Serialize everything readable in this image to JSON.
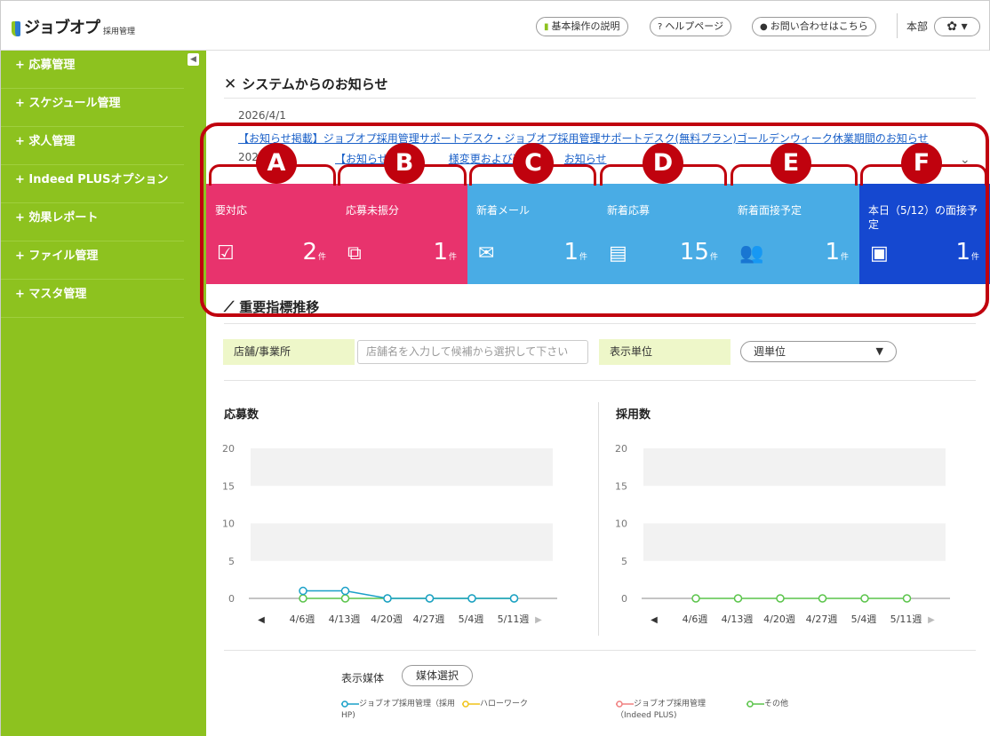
{
  "header": {
    "brand": "ジョブオプ",
    "brand_sub": "採用管理",
    "buttons": [
      {
        "icon": "▮",
        "label": "基本操作の説明"
      },
      {
        "icon": "?",
        "label": "ヘルプページ"
      },
      {
        "icon": "●",
        "label": "お問い合わせはこちら"
      }
    ],
    "user": "本部",
    "gear": "✿ ▾"
  },
  "sidebar": {
    "items": [
      {
        "label": "+ 応募管理"
      },
      {
        "label": "+ スケジュール管理"
      },
      {
        "label": "+ 求人管理"
      },
      {
        "label": "+ Indeed PLUSオプション"
      },
      {
        "label": "+ 効果レポート"
      },
      {
        "label": "+ ファイル管理"
      },
      {
        "label": "+ マスタ管理"
      }
    ],
    "collapse_icon": "◀"
  },
  "notices": {
    "title": "システムからのお知らせ",
    "date1": "2026/4/1",
    "link1": "【お知らせ掲載】ジョブオプ採用管理サポートデスク・ジョブオプ採用管理サポートデスク(無料プラン)ゴールデンウィーク休業期間のお知らせ",
    "date2": "202",
    "link2": "【お知らせ",
    "link2b": "様変更および運用",
    "link2c": "お知らせ",
    "more_icon": "⌄"
  },
  "tiles": [
    {
      "badge": "A",
      "label": "要対応",
      "count": "2",
      "unit": "件",
      "icon": "☑",
      "color": "#e8336d"
    },
    {
      "badge": "B",
      "label": "応募未振分",
      "count": "1",
      "unit": "件",
      "icon": "⧉",
      "color": "#e8336d"
    },
    {
      "badge": "C",
      "label": "新着メール",
      "count": "1",
      "unit": "件",
      "icon": "✉",
      "color": "#49ace5"
    },
    {
      "badge": "D",
      "label": "新着応募",
      "count": "15",
      "unit": "件",
      "icon": "▤",
      "color": "#49ace5"
    },
    {
      "badge": "E",
      "label": "新着面接予定",
      "count": "1",
      "unit": "件",
      "icon": "👥",
      "color": "#49ace5"
    },
    {
      "badge": "F",
      "label": "本日（5/12）の面接予定",
      "count": "1",
      "unit": "件",
      "icon": "▣",
      "color": "#1548d0"
    }
  ],
  "kpi": {
    "title": "重要指標推移",
    "store_label": "店舗/事業所",
    "store_placeholder": "店舗名を入力して候補から選択して下さい",
    "unit_label": "表示単位",
    "unit_value": "週単位",
    "unit_arrow": "▼"
  },
  "charts": {
    "legend_label": "表示媒体",
    "media_button": "媒体選択",
    "legend": [
      {
        "name": "ジョブオプ採用管理（採用HP)",
        "color": "#1aa0c8"
      },
      {
        "name": "ハローワーク",
        "color": "#f0c419"
      },
      {
        "name": "ジョブオプ採用管理（Indeed PLUS)",
        "color": "#f08080"
      },
      {
        "name": "その他",
        "color": "#5ac44a"
      }
    ],
    "nav_prev": "◀",
    "nav_next": "▶"
  },
  "chart_data": [
    {
      "type": "line",
      "title": "応募数",
      "categories": [
        "4/6週",
        "4/13週",
        "4/20週",
        "4/27週",
        "5/4週",
        "5/11週"
      ],
      "ylim": [
        0,
        20
      ],
      "yticks": [
        0,
        5,
        10,
        15,
        20
      ],
      "series": [
        {
          "name": "ジョブオプ採用管理（採用HP)",
          "color": "#1aa0c8",
          "values": [
            1,
            1,
            0,
            0,
            0,
            0
          ]
        },
        {
          "name": "その他",
          "color": "#5ac44a",
          "values": [
            0,
            0,
            0,
            0,
            0,
            0
          ]
        }
      ]
    },
    {
      "type": "line",
      "title": "採用数",
      "categories": [
        "4/6週",
        "4/13週",
        "4/20週",
        "4/27週",
        "5/4週",
        "5/11週"
      ],
      "ylim": [
        0,
        20
      ],
      "yticks": [
        0,
        5,
        10,
        15,
        20
      ],
      "series": [
        {
          "name": "その他",
          "color": "#5ac44a",
          "values": [
            0,
            0,
            0,
            0,
            0,
            0
          ]
        }
      ]
    }
  ]
}
